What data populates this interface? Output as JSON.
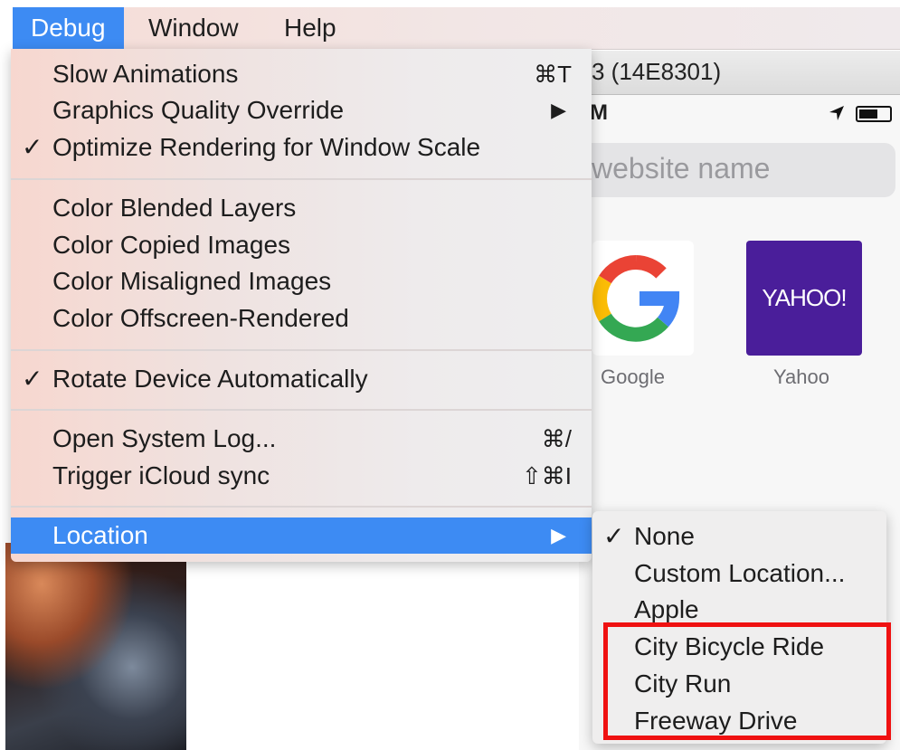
{
  "menubar": {
    "items": [
      {
        "label": "Debug",
        "active": true
      },
      {
        "label": "Window",
        "active": false
      },
      {
        "label": "Help",
        "active": false
      }
    ]
  },
  "simulator": {
    "title": "3 (14E8301)",
    "status_time": "M",
    "search_placeholder": "website name",
    "favorites": [
      {
        "label": "Google"
      },
      {
        "label": "Yahoo",
        "logo_text": "YAHOO!"
      }
    ]
  },
  "debug_menu": {
    "slow_animations": {
      "label": "Slow Animations",
      "shortcut": "⌘T"
    },
    "graphics_quality": {
      "label": "Graphics Quality Override",
      "arrow": "▶"
    },
    "optimize_rendering": {
      "label": "Optimize Rendering for Window Scale",
      "check": "✓"
    },
    "color_blended": {
      "label": "Color Blended Layers"
    },
    "color_copied": {
      "label": "Color Copied Images"
    },
    "color_misaligned": {
      "label": "Color Misaligned Images"
    },
    "color_offscreen": {
      "label": "Color Offscreen-Rendered"
    },
    "rotate_device": {
      "label": "Rotate Device Automatically",
      "check": "✓"
    },
    "open_system_log": {
      "label": "Open System Log...",
      "shortcut": "⌘/"
    },
    "trigger_icloud": {
      "label": "Trigger iCloud sync",
      "shortcut": "⇧⌘I"
    },
    "location": {
      "label": "Location",
      "arrow": "▶"
    }
  },
  "location_submenu": {
    "none": {
      "label": "None",
      "check": "✓"
    },
    "custom": {
      "label": "Custom Location..."
    },
    "apple": {
      "label": "Apple"
    },
    "city_bicycle": {
      "label": "City Bicycle Ride"
    },
    "city_run": {
      "label": "City Run"
    },
    "freeway": {
      "label": "Freeway Drive"
    }
  },
  "colors": {
    "highlight": "#3d8bf3",
    "annotation_box": "#ef1111",
    "yahoo_purple": "#4a1e9a"
  }
}
